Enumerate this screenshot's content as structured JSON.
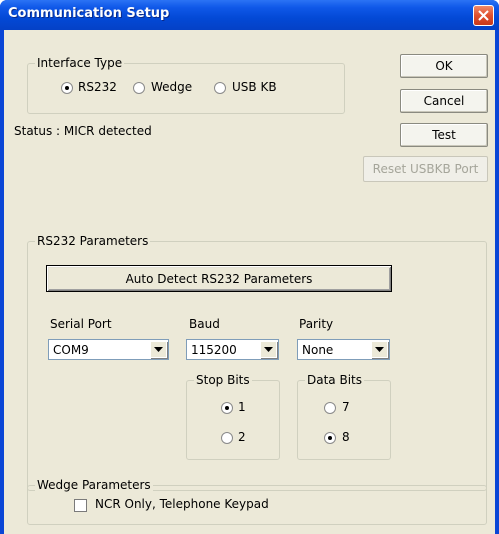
{
  "window": {
    "title": "Communication Setup"
  },
  "interface_type": {
    "legend": "Interface Type",
    "options": [
      {
        "label": "RS232",
        "selected": true
      },
      {
        "label": "Wedge",
        "selected": false
      },
      {
        "label": "USB KB",
        "selected": false
      }
    ]
  },
  "status": {
    "text": "Status : MICR detected"
  },
  "buttons": {
    "ok": "OK",
    "cancel": "Cancel",
    "test": "Test",
    "reset_usbkb": "Reset USBKB Port"
  },
  "rs232": {
    "legend": "RS232 Parameters",
    "auto_detect_label": "Auto Detect RS232 Parameters",
    "serial_port": {
      "label": "Serial Port",
      "value": "COM9"
    },
    "baud": {
      "label": "Baud",
      "value": "115200"
    },
    "parity": {
      "label": "Parity",
      "value": "None"
    },
    "stop_bits": {
      "legend": "Stop Bits",
      "options": [
        {
          "label": "1",
          "selected": true
        },
        {
          "label": "2",
          "selected": false
        }
      ]
    },
    "data_bits": {
      "legend": "Data Bits",
      "options": [
        {
          "label": "7",
          "selected": false
        },
        {
          "label": "8",
          "selected": true
        }
      ]
    }
  },
  "wedge": {
    "legend": "Wedge Parameters",
    "ncr_only_label": "NCR Only, Telephone Keypad",
    "ncr_only_checked": false
  }
}
